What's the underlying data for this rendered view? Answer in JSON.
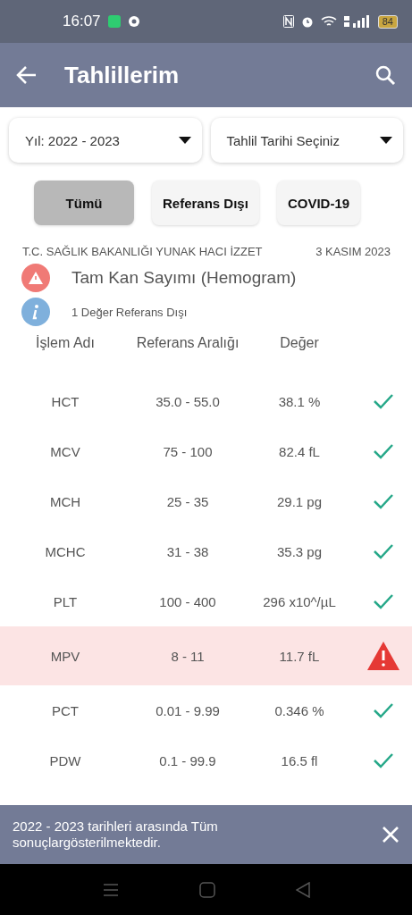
{
  "status_bar": {
    "time": "16:07",
    "battery": "84"
  },
  "app_bar": {
    "title": "Tahlillerim"
  },
  "filters": [
    {
      "label": "Yıl: 2022 - 2023"
    },
    {
      "label": "Tahlil Tarihi Seçiniz"
    }
  ],
  "chips": [
    {
      "label": "Tümü",
      "selected": true
    },
    {
      "label": "Referans Dışı",
      "selected": false
    },
    {
      "label": "COVID-19",
      "selected": false
    }
  ],
  "report": {
    "hospital": "T.C. SAĞLIK BAKANLIĞI YUNAK HACI İZZET",
    "date": "3 KASIM 2023",
    "test_name": "Tam Kan Sayımı (Hemogram)",
    "summary": "1 Değer Referans Dışı"
  },
  "table": {
    "columns": [
      "İşlem Adı",
      "Referans Aralığı",
      "Değer"
    ],
    "rows": [
      {
        "name": "HCT",
        "range": "35.0 - 55.0",
        "value": "38.1 %",
        "kind": "ok"
      },
      {
        "name": "MCV",
        "range": "75 - 100",
        "value": "82.4 fL",
        "kind": "ok"
      },
      {
        "name": "MCH",
        "range": "25 - 35",
        "value": "29.1 pg",
        "kind": "ok"
      },
      {
        "name": "MCHC",
        "range": "31 - 38",
        "value": "35.3 pg",
        "kind": "ok"
      },
      {
        "name": "PLT",
        "range": "100 - 400",
        "value": "296 x10^/µL",
        "kind": "ok"
      },
      {
        "name": "MPV",
        "range": "8 - 11",
        "value": "11.7 fL",
        "kind": "out"
      },
      {
        "name": "PCT",
        "range": "0.01 - 9.99",
        "value": "0.346 %",
        "kind": "ok"
      },
      {
        "name": "PDW",
        "range": "0.1 - 99.9",
        "value": "16.5 fl",
        "kind": "ok"
      }
    ]
  },
  "snackbar": {
    "message": "2022 - 2023 tarihleri arasında Tüm sonuçlargösterilmektedir."
  }
}
